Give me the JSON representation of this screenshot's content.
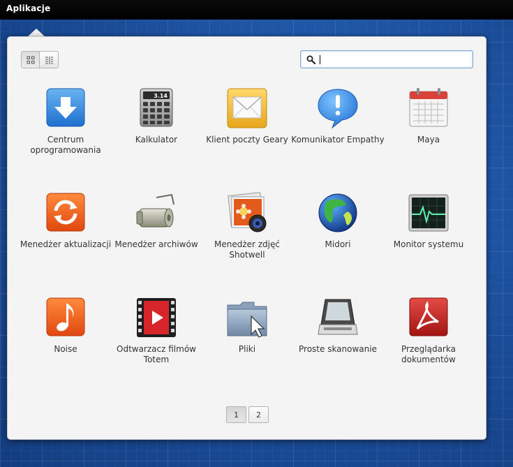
{
  "panel": {
    "title": "Aplikacje"
  },
  "search": {
    "value": "",
    "placeholder": ""
  },
  "view_modes": [
    "grid-view-icon",
    "category-view-icon"
  ],
  "apps": [
    {
      "label": "Centrum oprogramowania",
      "icon": "software-center-icon"
    },
    {
      "label": "Kalkulator",
      "icon": "calculator-icon",
      "display": "3.14"
    },
    {
      "label": "Klient poczty Geary",
      "icon": "mail-envelope-icon"
    },
    {
      "label": "Komunikator Empathy",
      "icon": "chat-bubble-icon"
    },
    {
      "label": "Maya",
      "icon": "calendar-icon"
    },
    {
      "label": "Menedżer aktualizacji",
      "icon": "update-arrows-icon"
    },
    {
      "label": "Menedżer archiwów",
      "icon": "archive-roller-icon"
    },
    {
      "label": "Menedżer zdjęć Shotwell",
      "icon": "photos-camera-icon"
    },
    {
      "label": "Midori",
      "icon": "globe-icon"
    },
    {
      "label": "Monitor systemu",
      "icon": "monitor-pulse-icon"
    },
    {
      "label": "Noise",
      "icon": "music-note-icon"
    },
    {
      "label": "Odtwarzacz filmów Totem",
      "icon": "film-play-icon"
    },
    {
      "label": "Pliki",
      "icon": "folder-cursor-icon"
    },
    {
      "label": "Proste skanowanie",
      "icon": "scanner-icon"
    },
    {
      "label": "Przeglądarka dokumentów",
      "icon": "pdf-document-icon"
    }
  ],
  "pager": {
    "pages": [
      "1",
      "2"
    ],
    "current": "1"
  },
  "colors": {
    "desktop": "#1e55a6",
    "panel": "#000000",
    "popover": "#f4f4f4"
  }
}
